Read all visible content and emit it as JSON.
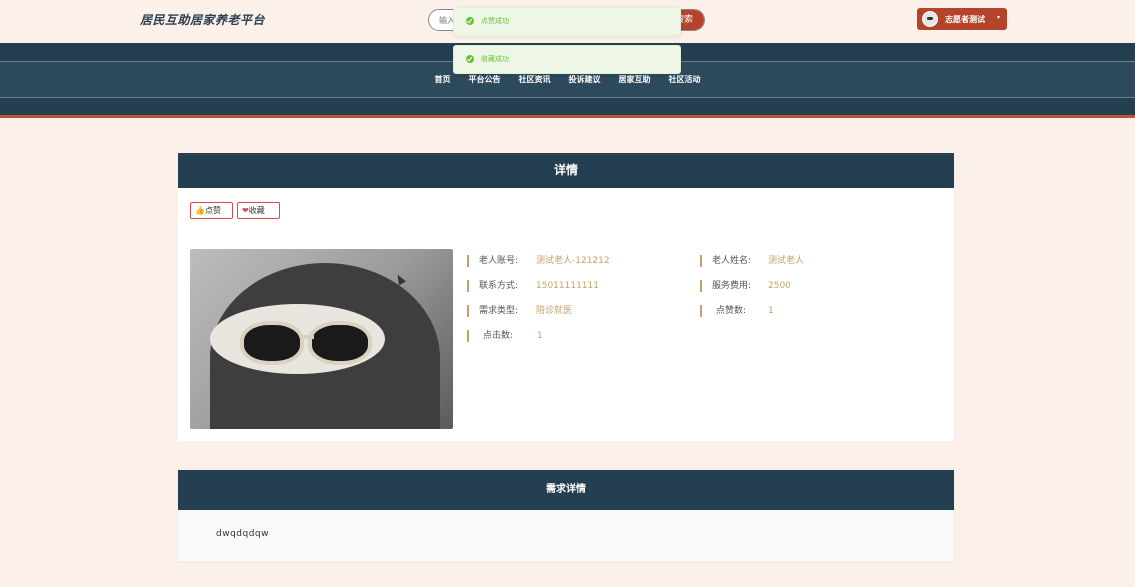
{
  "header": {
    "site_title": "居民互助居家养老平台",
    "search_placeholder": "输入",
    "search_button": "搜索",
    "user_name": "志愿者测试",
    "user_caret": "▾"
  },
  "nav": {
    "items": [
      "首页",
      "平台公告",
      "社区资讯",
      "投诉建议",
      "居家互助",
      "社区活动"
    ]
  },
  "toasts": [
    {
      "text": "点赞成功"
    },
    {
      "text": "收藏成功"
    }
  ],
  "detail": {
    "title": "详情",
    "like_icon": "👍",
    "like_label": "点赞",
    "fav_icon": "❤",
    "fav_label": "收藏",
    "fields": [
      {
        "label": "老人账号:",
        "value": "测试老人-121212"
      },
      {
        "label": "老人姓名:",
        "value": "测试老人"
      },
      {
        "label": "联系方式:",
        "value": "15011111111"
      },
      {
        "label": "服务费用:",
        "value": "2500"
      },
      {
        "label": "需求类型:",
        "value": "陪诊就医"
      },
      {
        "label": "点赞数:",
        "value": "1"
      },
      {
        "label": "点击数:",
        "value": "1"
      }
    ]
  },
  "requirement": {
    "title": "需求详情",
    "content": "dwqdqdqw"
  },
  "colors": {
    "brand_dark": "#243f52",
    "accent": "#b5422a",
    "value_gold": "#c6a06a",
    "success": "#67c23a"
  }
}
